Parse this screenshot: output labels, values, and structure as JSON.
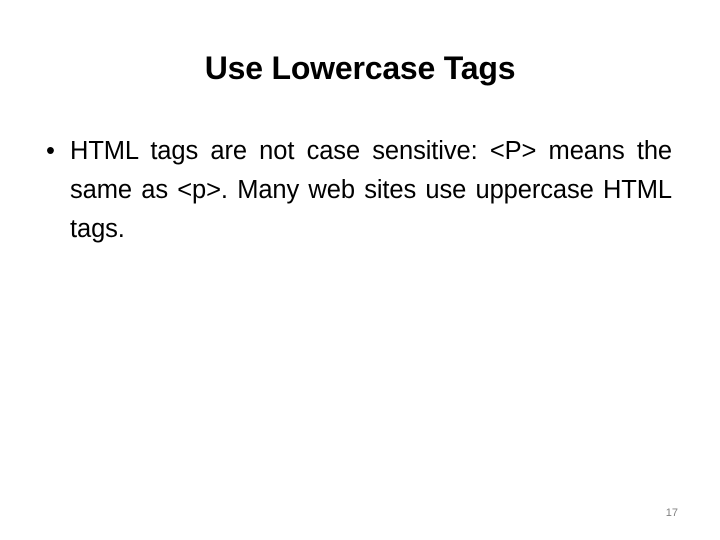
{
  "slide": {
    "title": "Use Lowercase Tags",
    "background_color": "#ffffff",
    "text_color": "#000000",
    "bullets": [
      {
        "marker": "bullet-dot",
        "marker_glyph": "•",
        "text": "HTML tags are not case sensitive: <P> means the same as <p>. Many web sites use uppercase HTML tags."
      }
    ],
    "page_number": "17",
    "page_number_color": "#808080"
  }
}
